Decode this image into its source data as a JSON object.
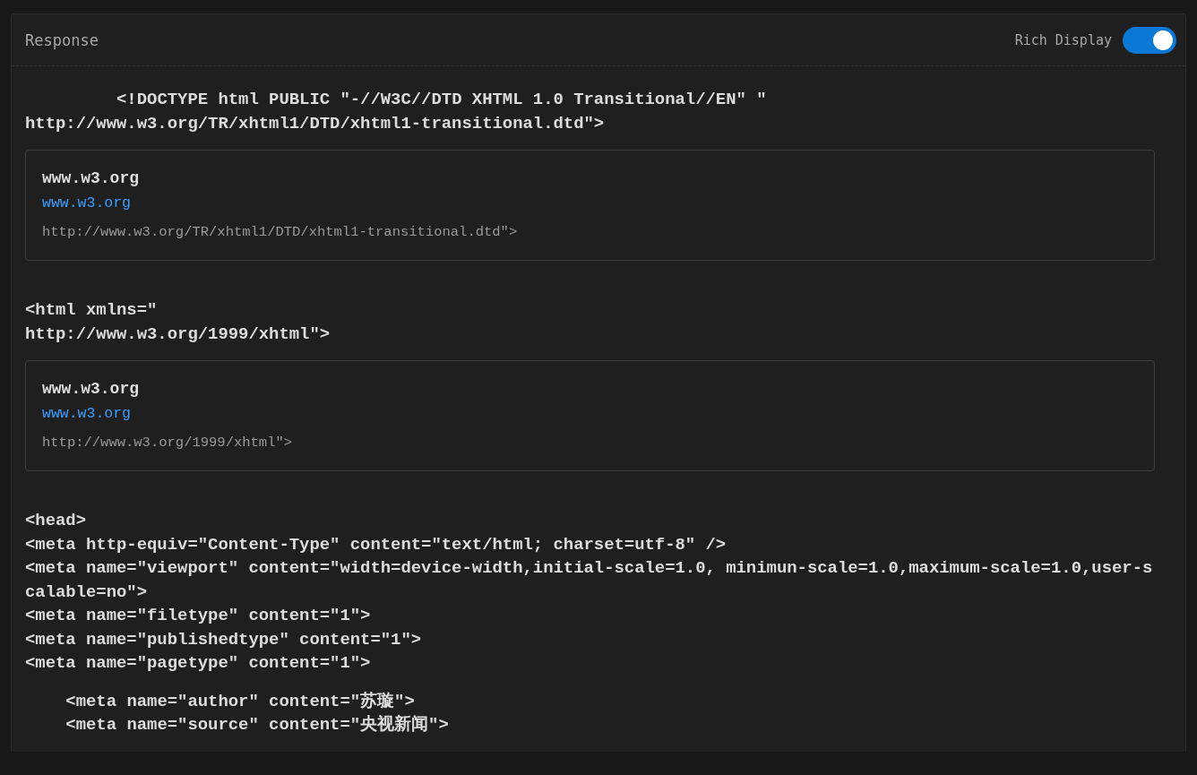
{
  "header": {
    "title": "Response",
    "toggle": {
      "label": "Rich Display",
      "on": true
    }
  },
  "blocks": [
    {
      "kind": "code",
      "lines": [
        "         <!DOCTYPE html PUBLIC \"-//W3C//DTD XHTML 1.0 Transitional//EN\" \"",
        "http://www.w3.org/TR/xhtml1/DTD/xhtml1-transitional.dtd\">"
      ]
    },
    {
      "kind": "card",
      "title": "www.w3.org",
      "link": "www.w3.org",
      "url": "http://www.w3.org/TR/xhtml1/DTD/xhtml1-transitional.dtd\">"
    },
    {
      "kind": "code",
      "lines": [
        "<html xmlns=\"",
        "http://www.w3.org/1999/xhtml\">"
      ]
    },
    {
      "kind": "card",
      "title": "www.w3.org",
      "link": "www.w3.org",
      "url": "http://www.w3.org/1999/xhtml\">"
    },
    {
      "kind": "code",
      "lines": [
        "<head>",
        "<meta http-equiv=\"Content-Type\" content=\"text/html; charset=utf-8\" />",
        "<meta name=\"viewport\" content=\"width=device-width,initial-scale=1.0, minimun-scale=1.0,maximum-scale=1.0,user-scalable=no\">",
        "<meta name=\"filetype\" content=\"1\">",
        "<meta name=\"publishedtype\" content=\"1\">",
        "<meta name=\"pagetype\" content=\"1\">"
      ]
    },
    {
      "kind": "code",
      "lines": [
        "    <meta name=\"author\" content=\"苏璇\">",
        "    <meta name=\"source\" content=\"央视新闻\">"
      ]
    }
  ]
}
